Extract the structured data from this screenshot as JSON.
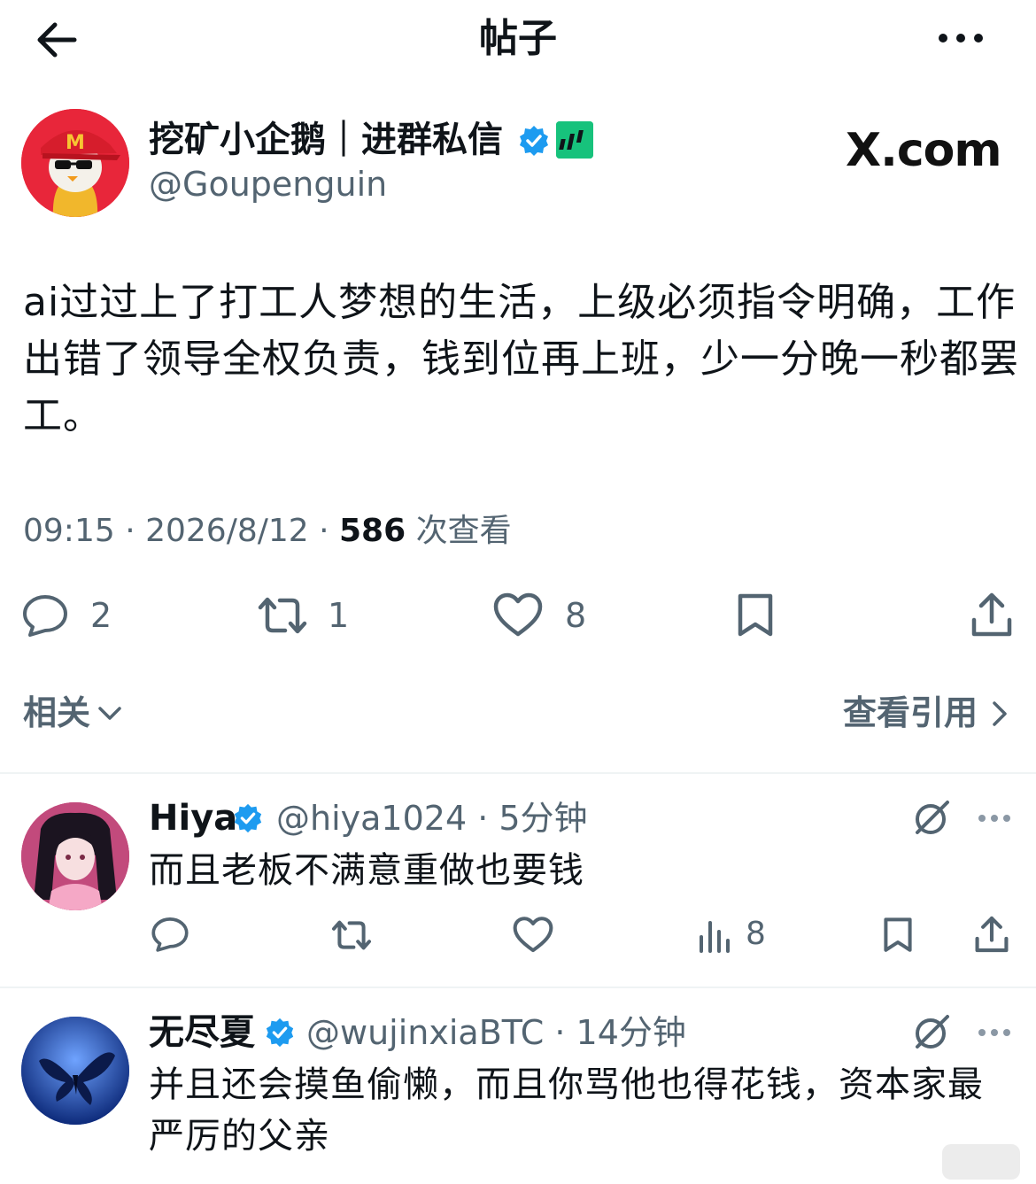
{
  "header": {
    "title": "帖子",
    "back_icon": "arrow-left-icon",
    "more_icon": "more-horizontal-icon"
  },
  "post": {
    "author_name": "挖矿小企鹅｜进群私信",
    "author_handle": "@Goupenguin",
    "brand": "X.com",
    "text": "ai过过上了打工人梦想的生活，上级必须指令明确，工作出错了领导全权负责，钱到位再上班，少一分晚一秒都罢工。",
    "time": "09:15 · 2026/8/12 · ",
    "views_count": "586",
    "views_label": " 次查看",
    "replies": "2",
    "reposts": "1",
    "likes": "8"
  },
  "related": {
    "label": "相关",
    "quotes_label": "查看引用"
  },
  "replies": [
    {
      "name": "Hiya",
      "handle": "@hiya1024 · 5分钟",
      "text": "而且老板不满意重做也要钱",
      "views": "8"
    },
    {
      "name": "无尽夏",
      "handle": "@wujinxiaBTC · 14分钟",
      "text": "并且还会摸鱼偷懒，而且你骂他也得花钱，资本家最严厉的父亲"
    }
  ],
  "colors": {
    "verified": "#1d9bf0",
    "muted": "#536471",
    "text": "#0f1419",
    "badge": "#17c27c"
  }
}
